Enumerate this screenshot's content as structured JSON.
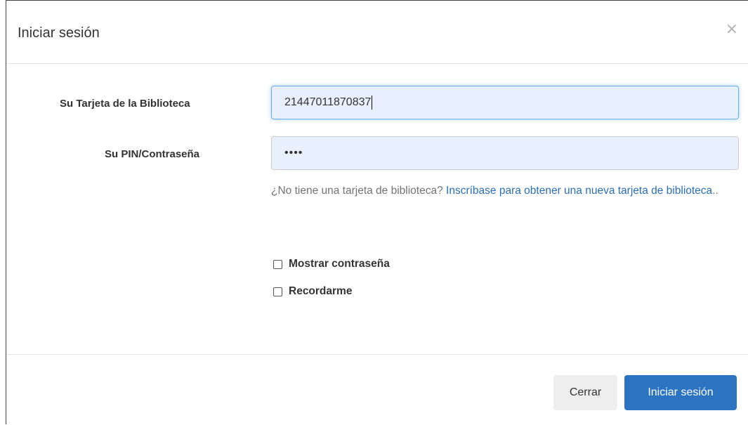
{
  "modal": {
    "title": "Iniciar sesión",
    "close_symbol": "×"
  },
  "form": {
    "card_label": "Su Tarjeta de la Biblioteca",
    "card_value": "21447011870837",
    "pin_label": "Su PIN/Contraseña",
    "pin_value": "••••",
    "help_text": "¿No tiene una tarjeta de biblioteca? ",
    "help_link": "Inscríbase para obtener una nueva tarjeta de biblioteca",
    "help_suffix": "..",
    "show_password_label": "Mostrar contraseña",
    "show_password_checked": false,
    "remember_me_label": "Recordarme",
    "remember_me_checked": false
  },
  "footer": {
    "close_label": "Cerrar",
    "submit_label": "Iniciar sesión"
  },
  "colors": {
    "primary": "#2c74c2",
    "link": "#2a6fb3",
    "input_autofill_bg": "#e8f0fe"
  },
  "icons": {
    "close": "close-icon"
  }
}
